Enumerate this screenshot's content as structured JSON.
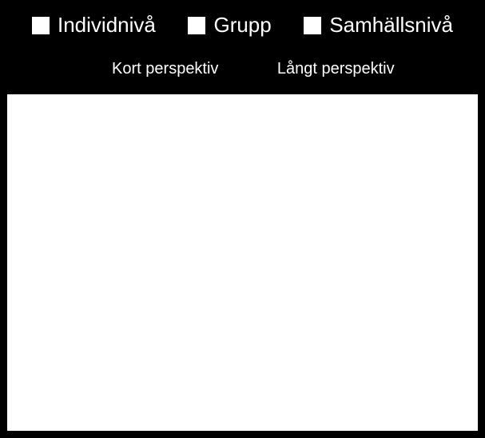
{
  "legend": {
    "items": [
      {
        "label": "Individnivå"
      },
      {
        "label": "Grupp"
      },
      {
        "label": "Samhällsnivå"
      }
    ]
  },
  "axis": {
    "left": "Kort perspektiv",
    "right": "Långt perspektiv"
  }
}
